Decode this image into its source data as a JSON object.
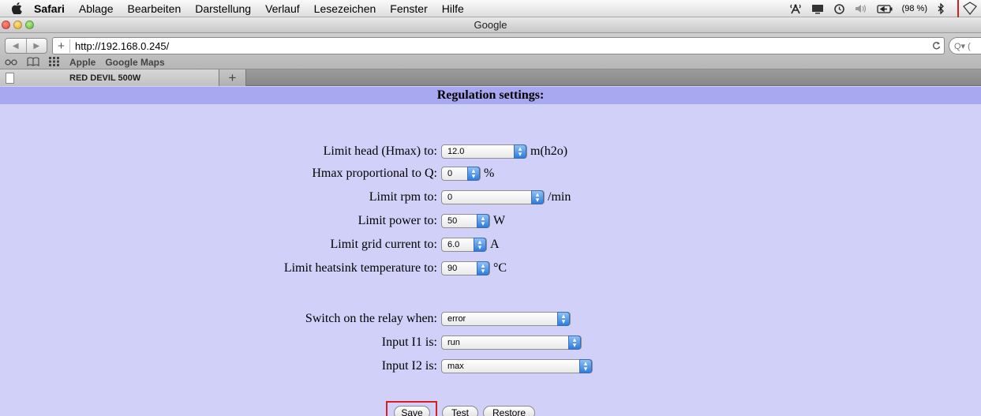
{
  "menubar": {
    "app_name": "Safari",
    "items": [
      "Ablage",
      "Bearbeiten",
      "Darstellung",
      "Verlauf",
      "Lesezeichen",
      "Fenster",
      "Hilfe"
    ],
    "battery": "(98 %)"
  },
  "window": {
    "title": "Google"
  },
  "toolbar": {
    "url": "http://192.168.0.245/",
    "search_prefix": "Q▾ ("
  },
  "bookmarks": [
    "Apple",
    "Google Maps"
  ],
  "tab": {
    "title": "RED DEVIL 500W"
  },
  "page": {
    "header": "Regulation settings:",
    "fields": [
      {
        "label": "Limit head (Hmax) to:",
        "value": "12.0",
        "unit": "m(h2o)"
      },
      {
        "label": "Hmax proportional to Q:",
        "value": "0",
        "unit": "%"
      },
      {
        "label": "Limit rpm to:",
        "value": "0",
        "unit": "/min"
      },
      {
        "label": "Limit power to:",
        "value": "50",
        "unit": "W"
      },
      {
        "label": "Limit grid current to:",
        "value": "6.0",
        "unit": "A"
      },
      {
        "label": "Limit heatsink temperature to:",
        "value": "90",
        "unit": "°C"
      }
    ],
    "relay": [
      {
        "label": "Switch on the relay when:",
        "value": "error"
      },
      {
        "label": "Input I1 is:",
        "value": "run"
      },
      {
        "label": "Input I2 is:",
        "value": "max"
      }
    ],
    "buttons": {
      "save": "Save",
      "test": "Test",
      "restore": "Restore"
    }
  },
  "colors": {
    "page_bg": "#d0d0f8",
    "header_bg": "#a8a8f0",
    "highlight": "#d21f1f"
  }
}
